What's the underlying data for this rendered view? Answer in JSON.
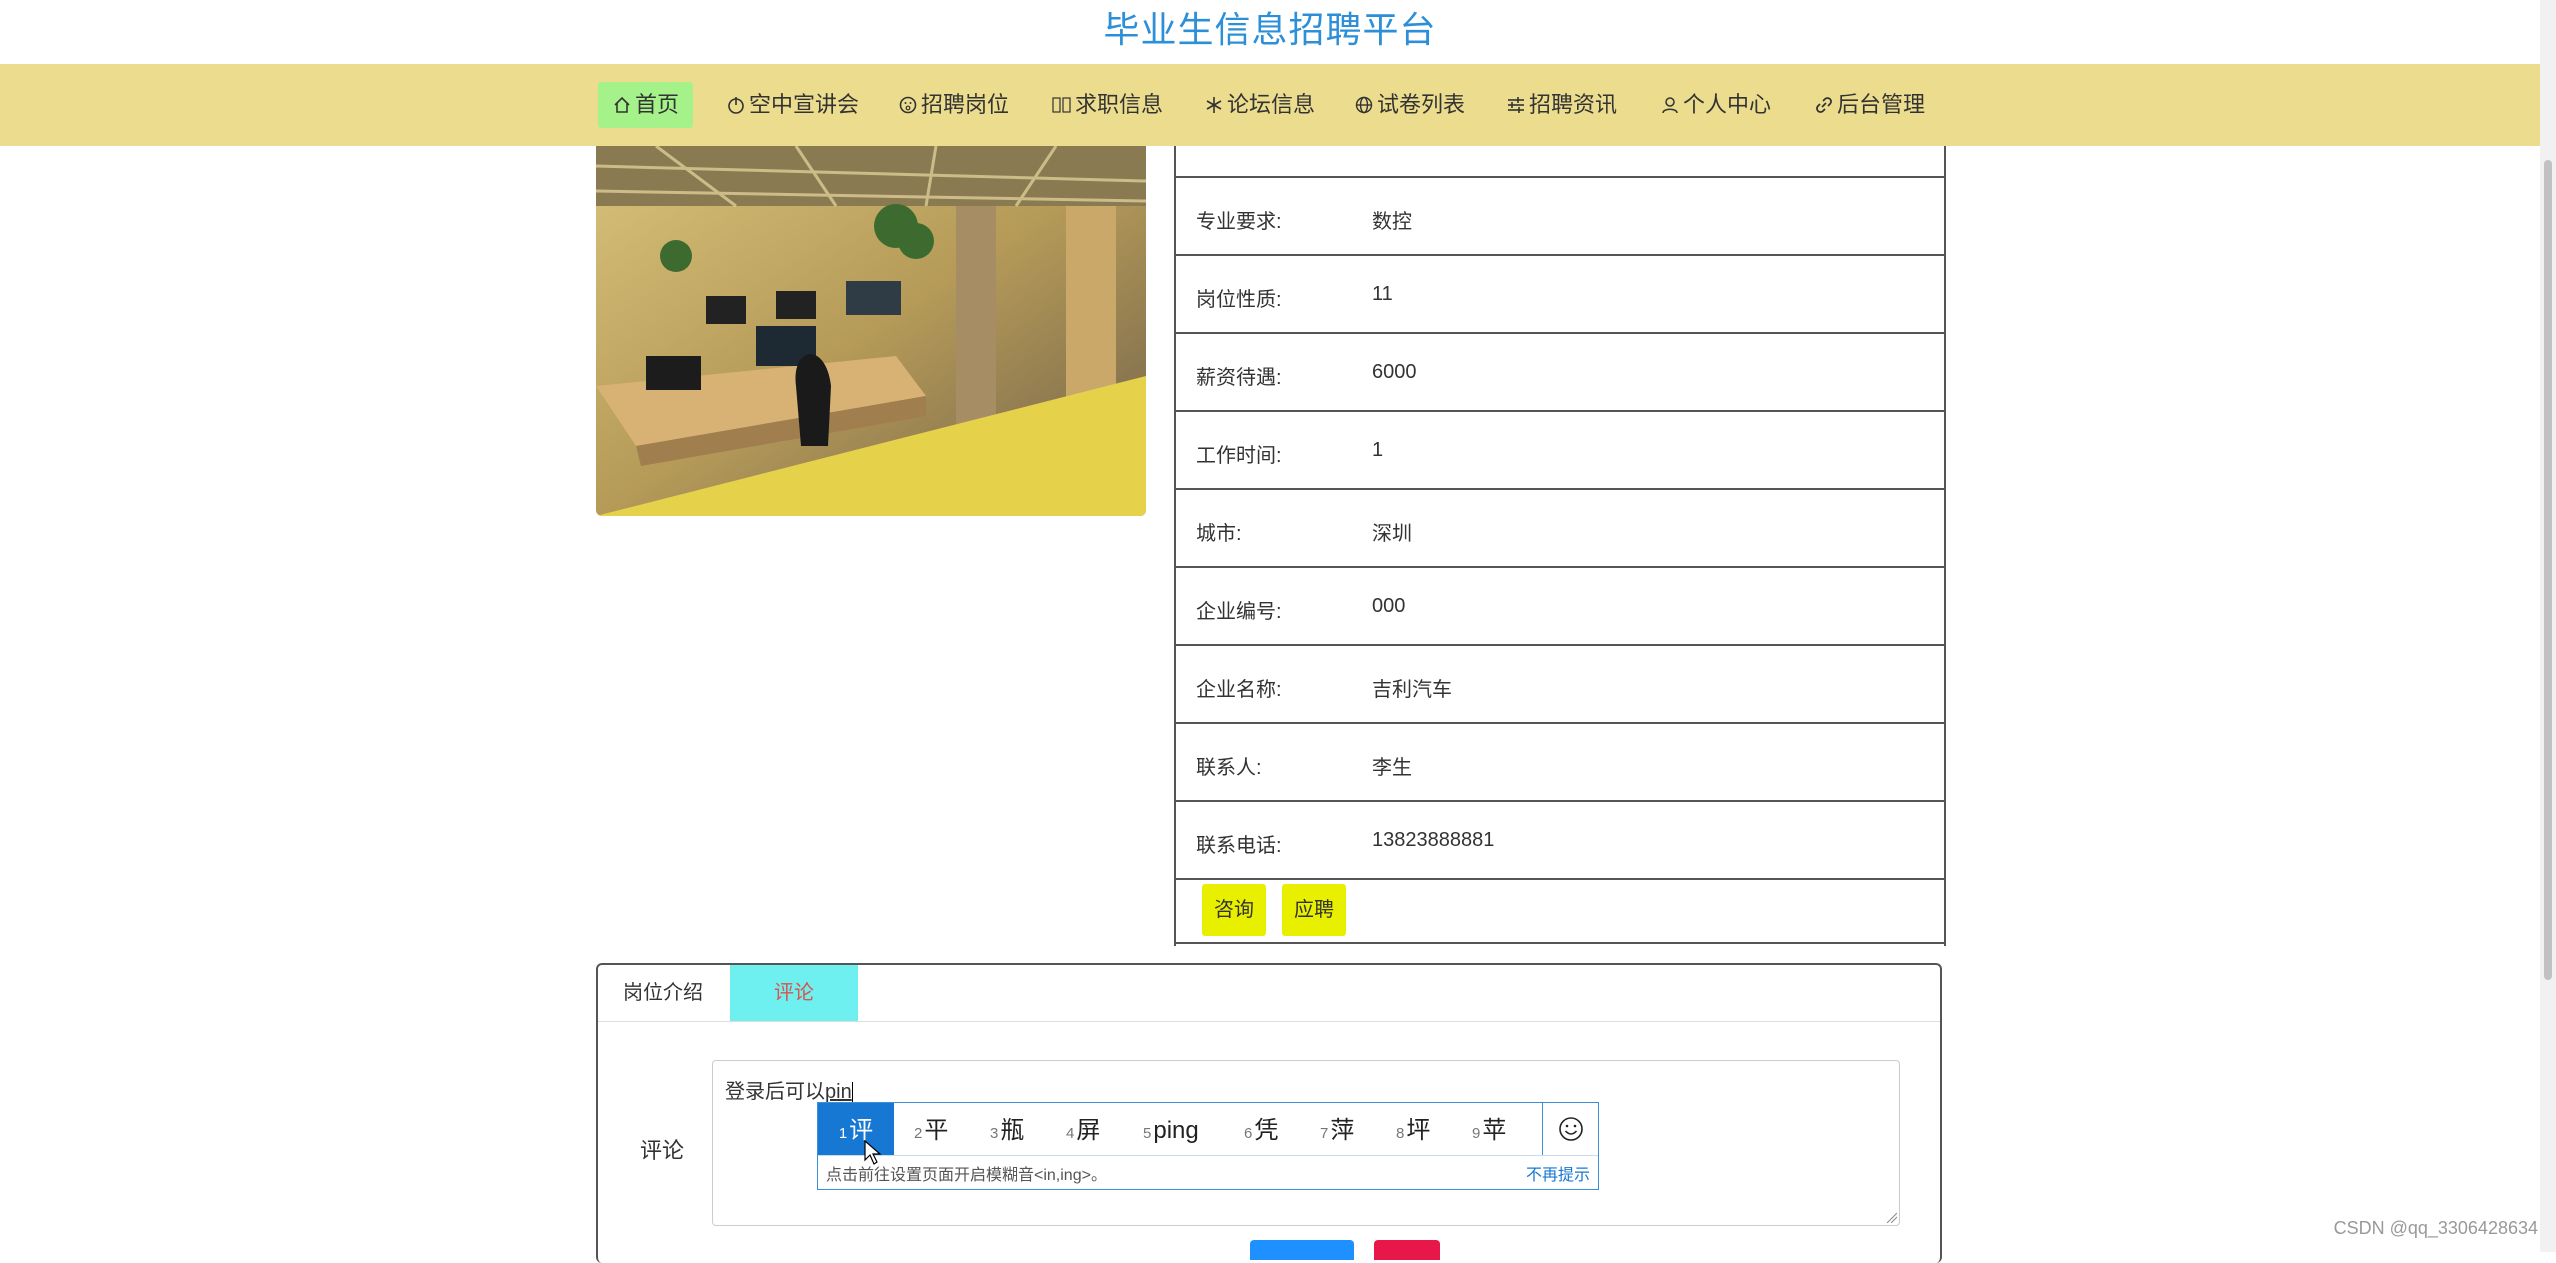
{
  "site": {
    "title": "毕业生信息招聘平台"
  },
  "nav": {
    "items": [
      {
        "label": "首页",
        "icon": "home-icon",
        "active": true
      },
      {
        "label": "空中宣讲会",
        "icon": "power-icon"
      },
      {
        "label": "招聘岗位",
        "icon": "face-icon"
      },
      {
        "label": "求职信息",
        "icon": "missing-glyph-icon"
      },
      {
        "label": "论坛信息",
        "icon": "snowflake-icon"
      },
      {
        "label": "试卷列表",
        "icon": "globe-icon"
      },
      {
        "label": "招聘资讯",
        "icon": "sliders-icon"
      },
      {
        "label": "个人中心",
        "icon": "user-icon"
      },
      {
        "label": "后台管理",
        "icon": "link-icon"
      }
    ]
  },
  "details": {
    "rows": [
      {
        "label": "专业要求:",
        "value": "数控"
      },
      {
        "label": "岗位性质:",
        "value": "11"
      },
      {
        "label": "薪资待遇:",
        "value": "6000"
      },
      {
        "label": "工作时间:",
        "value": "1"
      },
      {
        "label": "城市:",
        "value": "深圳"
      },
      {
        "label": "企业编号:",
        "value": "000"
      },
      {
        "label": "企业名称:",
        "value": "吉利汽车"
      },
      {
        "label": "联系人:",
        "value": "李生"
      },
      {
        "label": "联系电话:",
        "value": "13823888881"
      }
    ],
    "actions": {
      "consult": "咨询",
      "apply": "应聘"
    }
  },
  "tabs": [
    {
      "label": "岗位介绍"
    },
    {
      "label": "评论",
      "active": true
    }
  ],
  "comment": {
    "label": "评论",
    "text": "登录后可以",
    "composing": "pin"
  },
  "ime": {
    "candidates": [
      {
        "num": "1",
        "text": "评"
      },
      {
        "num": "2",
        "text": "平"
      },
      {
        "num": "3",
        "text": "瓶"
      },
      {
        "num": "4",
        "text": "屏"
      },
      {
        "num": "5",
        "text": "ping"
      },
      {
        "num": "6",
        "text": "凭"
      },
      {
        "num": "7",
        "text": "萍"
      },
      {
        "num": "8",
        "text": "坪"
      },
      {
        "num": "9",
        "text": "苹"
      }
    ],
    "hint": "点击前往设置页面开启模糊音<in,ing>。",
    "dismiss": "不再提示",
    "emoji_icon": "smiley-icon"
  },
  "watermark": "CSDN @qq_3306428634",
  "colors": {
    "title": "#2c8fd8",
    "navbar": "#ebdc8e",
    "nav_active": "#a6f28a",
    "action_button": "#e8f000",
    "tab_active": "#6ff0f0",
    "ime_selected": "#1678d2"
  }
}
